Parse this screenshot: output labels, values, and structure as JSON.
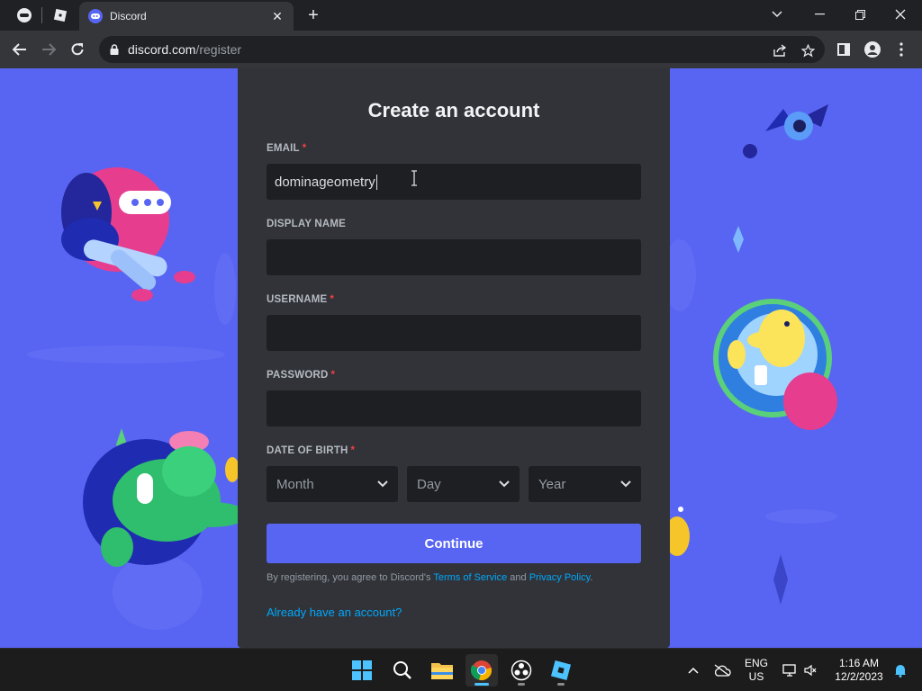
{
  "browser": {
    "active_tab_title": "Discord",
    "url_host": "discord.com",
    "url_path": "/register"
  },
  "form": {
    "title": "Create an account",
    "email_label": "EMAIL",
    "email_value": "dominageometry",
    "display_name_label": "DISPLAY NAME",
    "display_name_value": "",
    "username_label": "USERNAME",
    "username_value": "",
    "password_label": "PASSWORD",
    "password_value": "",
    "dob_label": "DATE OF BIRTH",
    "required_marker": "*",
    "month_placeholder": "Month",
    "day_placeholder": "Day",
    "year_placeholder": "Year",
    "continue_label": "Continue",
    "legal_prefix": "By registering, you agree to Discord's ",
    "tos_link": "Terms of Service",
    "legal_and": " and ",
    "privacy_link": "Privacy Policy",
    "legal_suffix": ".",
    "login_link": "Already have an account?"
  },
  "taskbar": {
    "language": "ENG",
    "region": "US",
    "time": "1:16 AM",
    "date": "12/2/2023"
  },
  "colors": {
    "blurple": "#5865f2",
    "card_bg": "#313338",
    "input_bg": "#1e1f22",
    "link": "#00a8fc",
    "required": "#f23f42"
  }
}
